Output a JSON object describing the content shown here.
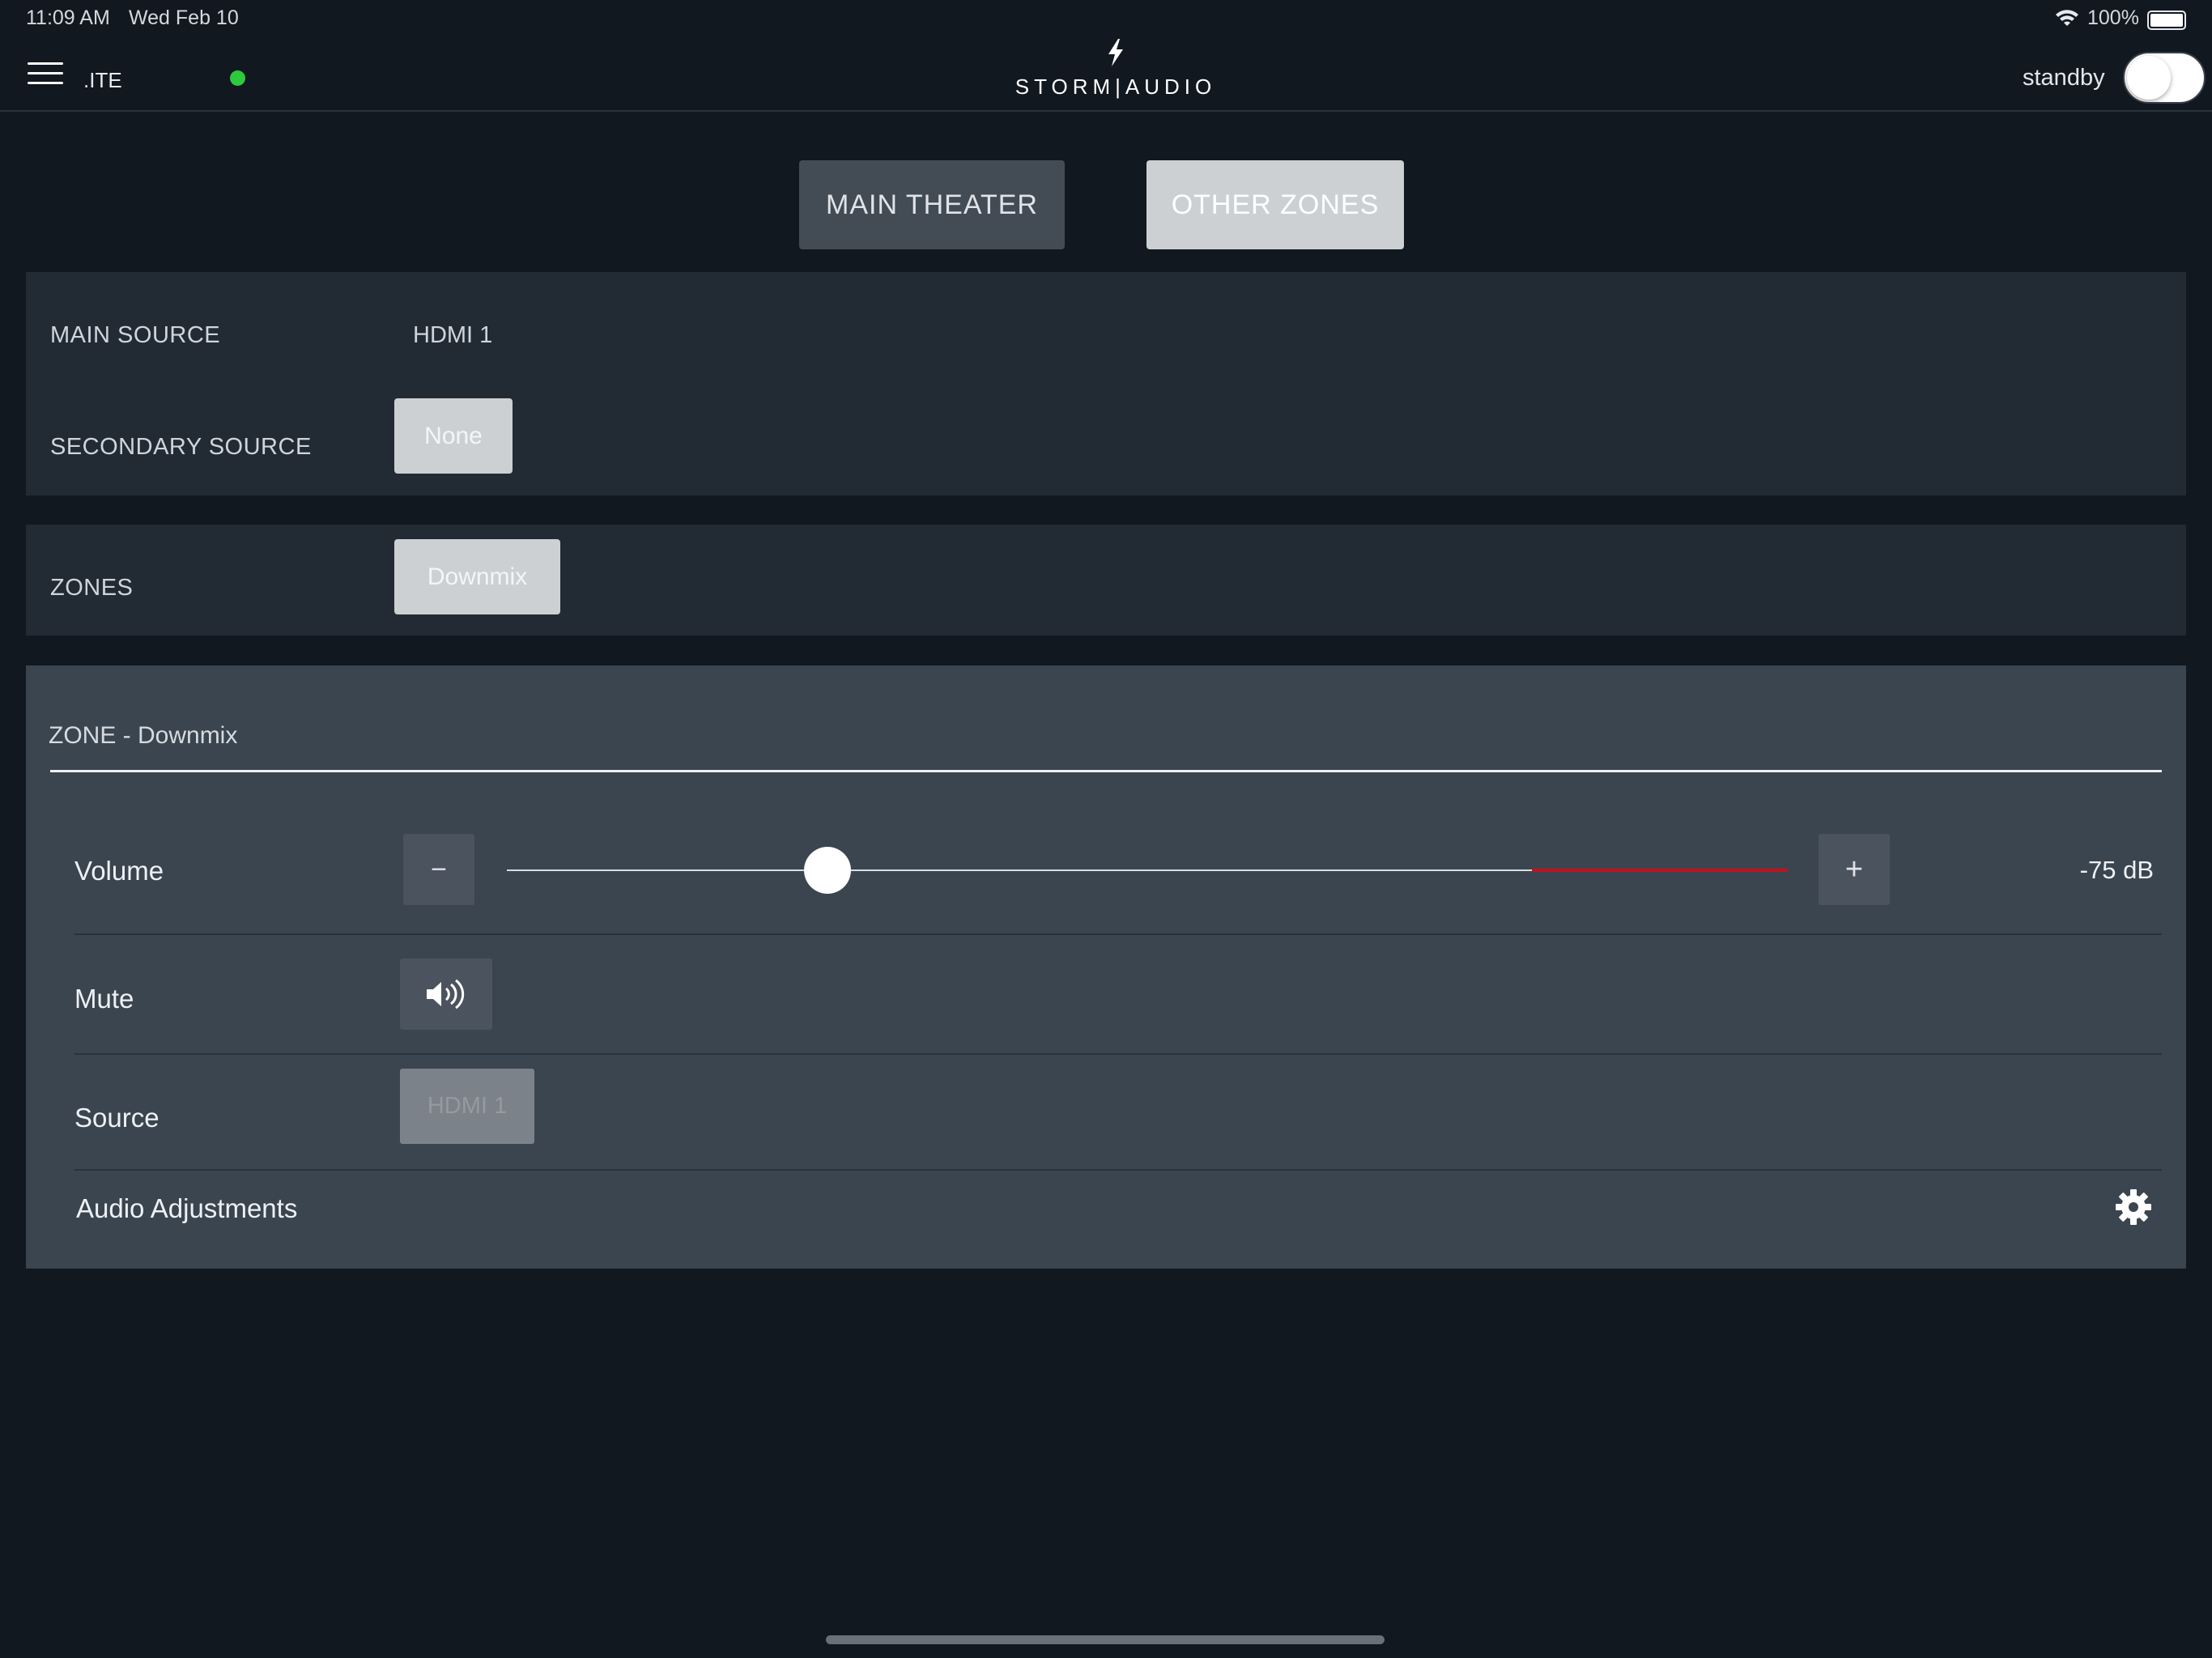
{
  "status_bar": {
    "time": "11:09 AM",
    "date": "Wed Feb 10",
    "battery": "100%"
  },
  "header": {
    "site_name": ".ITE",
    "logo_text": "STORM|AUDIO",
    "standby_label": "standby",
    "standby_on": false,
    "connection_color": "#2ec93c"
  },
  "tabs": [
    {
      "label": "MAIN THEATER",
      "active": false
    },
    {
      "label": "OTHER ZONES",
      "active": true
    }
  ],
  "sources": {
    "main_label": "MAIN SOURCE",
    "main_value": "HDMI 1",
    "secondary_label": "SECONDARY SOURCE",
    "secondary_value": "None"
  },
  "zones": {
    "label": "ZONES",
    "value": "Downmix"
  },
  "zone_detail": {
    "title": "ZONE - Downmix",
    "volume_label": "Volume",
    "volume_minus": "−",
    "volume_plus": "+",
    "volume_value": "-75 dB",
    "volume_level": 0.25,
    "volume_limit_level": 0.8,
    "mute_label": "Mute",
    "mute_icon": "speaker-icon",
    "source_label": "Source",
    "source_value": "HDMI 1",
    "audio_adjustments_label": "Audio Adjustments",
    "settings_icon": "gear-icon"
  },
  "colors": {
    "accent_red": "#c2121c",
    "background": "#111820"
  }
}
